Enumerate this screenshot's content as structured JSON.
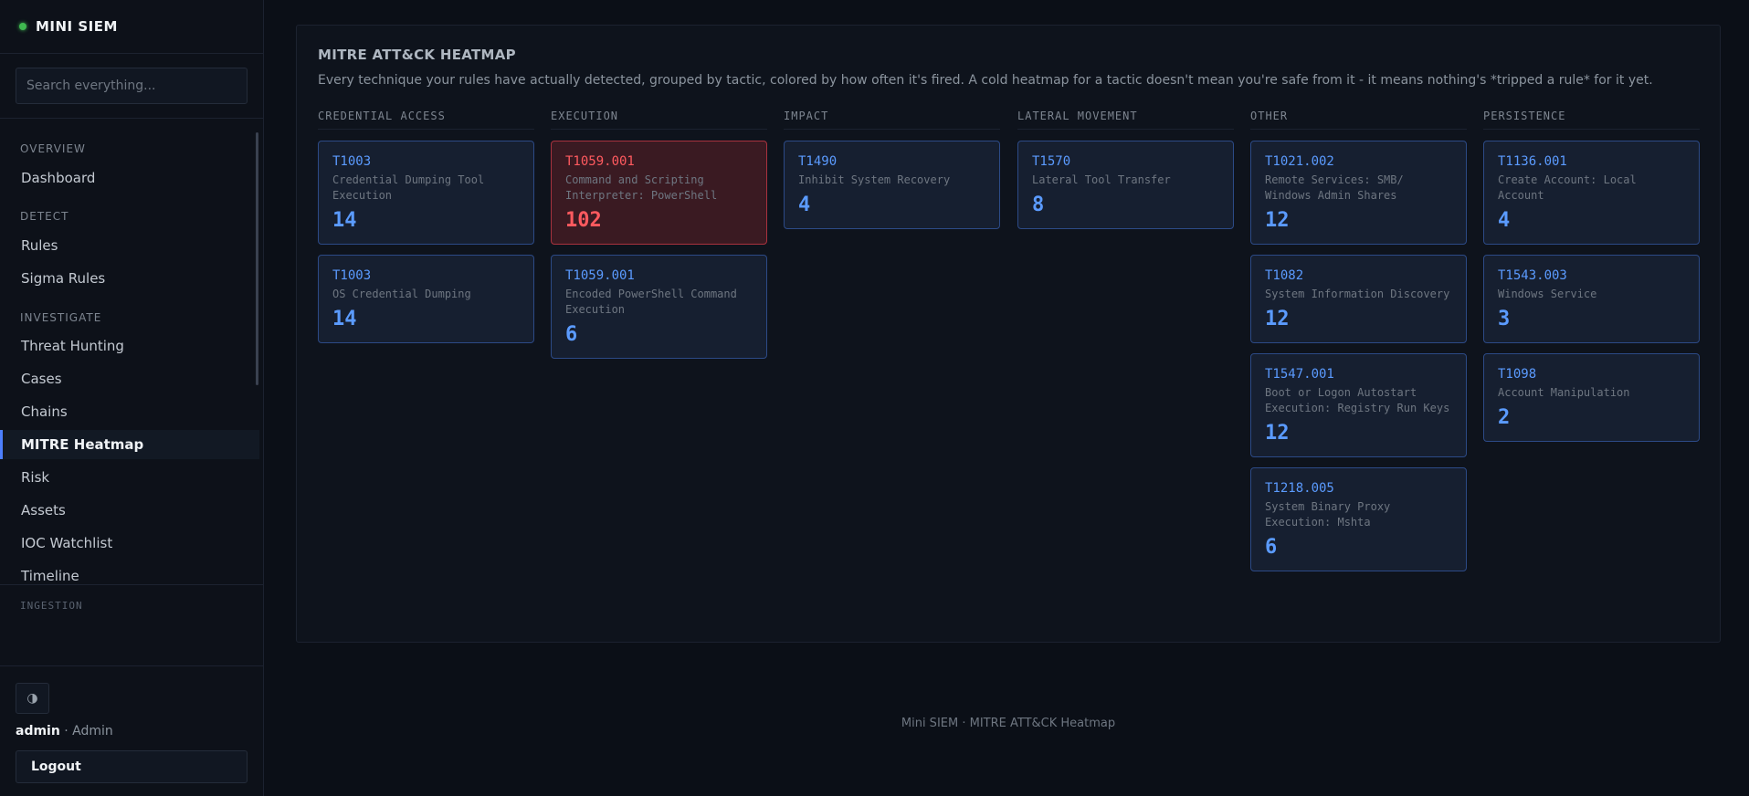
{
  "brand": {
    "name": "MINI SIEM",
    "status_color": "#3fb950"
  },
  "search": {
    "placeholder": "Search everything..."
  },
  "nav": {
    "sections": {
      "overview": "OVERVIEW",
      "detect": "DETECT",
      "investigate": "INVESTIGATE",
      "ingestion": "INGESTION"
    },
    "items": {
      "dashboard": "Dashboard",
      "rules": "Rules",
      "sigma_rules": "Sigma Rules",
      "threat_hunting": "Threat Hunting",
      "cases": "Cases",
      "chains": "Chains",
      "mitre_heatmap": "MITRE Heatmap",
      "risk": "Risk",
      "assets": "Assets",
      "ioc_watchlist": "IOC Watchlist",
      "timeline": "Timeline"
    },
    "active": "MITRE Heatmap"
  },
  "footer_sidebar": {
    "theme_icon": "◑",
    "user_name": "admin",
    "user_role": " · Admin",
    "logout_label": "Logout"
  },
  "heatmap": {
    "title": "MITRE ATT&CK HEATMAP",
    "description": "Every technique your rules have actually detected, grouped by tactic, colored by how often it's fired. A cold heatmap for a tactic doesn't mean you're safe from it - it means nothing's *tripped a rule* for it yet.",
    "colors": {
      "normal": "#5b9bff",
      "hot": "#ff5a5f"
    },
    "tactics": [
      {
        "name": "CREDENTIAL ACCESS",
        "techniques": [
          {
            "id": "T1003",
            "name": "Credential Dumping Tool Execution",
            "count": "14",
            "hot": false
          },
          {
            "id": "T1003",
            "name": "OS Credential Dumping",
            "count": "14",
            "hot": false
          }
        ]
      },
      {
        "name": "EXECUTION",
        "techniques": [
          {
            "id": "T1059.001",
            "name": "Command and Scripting Interpreter: PowerShell",
            "count": "102",
            "hot": true
          },
          {
            "id": "T1059.001",
            "name": "Encoded PowerShell Command Execution",
            "count": "6",
            "hot": false
          }
        ]
      },
      {
        "name": "IMPACT",
        "techniques": [
          {
            "id": "T1490",
            "name": "Inhibit System Recovery",
            "count": "4",
            "hot": false
          }
        ]
      },
      {
        "name": "LATERAL MOVEMENT",
        "techniques": [
          {
            "id": "T1570",
            "name": "Lateral Tool Transfer",
            "count": "8",
            "hot": false
          }
        ]
      },
      {
        "name": "OTHER",
        "techniques": [
          {
            "id": "T1021.002",
            "name": "Remote Services: SMB/ Windows Admin Shares",
            "count": "12",
            "hot": false
          },
          {
            "id": "T1082",
            "name": "System Information Discovery",
            "count": "12",
            "hot": false
          },
          {
            "id": "T1547.001",
            "name": "Boot or Logon Autostart Execution: Registry Run Keys",
            "count": "12",
            "hot": false
          },
          {
            "id": "T1218.005",
            "name": "System Binary Proxy Execution: Mshta",
            "count": "6",
            "hot": false
          }
        ]
      },
      {
        "name": "PERSISTENCE",
        "techniques": [
          {
            "id": "T1136.001",
            "name": "Create Account: Local Account",
            "count": "4",
            "hot": false
          },
          {
            "id": "T1543.003",
            "name": "Windows Service",
            "count": "3",
            "hot": false
          },
          {
            "id": "T1098",
            "name": "Account Manipulation",
            "count": "2",
            "hot": false
          }
        ]
      }
    ]
  },
  "page_footer": "Mini SIEM · MITRE ATT&CK Heatmap"
}
